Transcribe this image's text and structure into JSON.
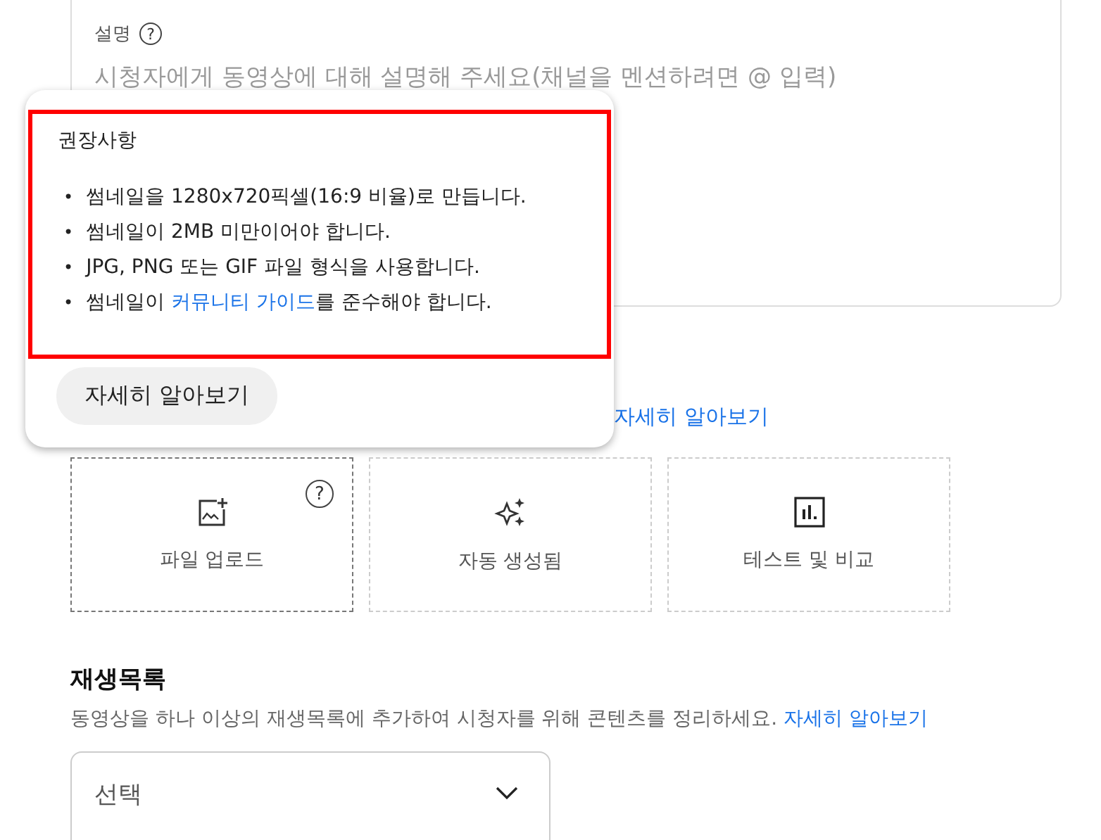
{
  "description": {
    "label": "설명",
    "help_icon": "?",
    "placeholder": "시청자에게 동영상에 대해 설명해 주세요(채널을 멘션하려면 @ 입력)"
  },
  "popup": {
    "title": "권장사항",
    "highlighted": true,
    "items": [
      {
        "bullet": "•",
        "text": "썸네일을 1280x720픽셀(16:9 비율)로 만듭니다."
      },
      {
        "bullet": "•",
        "text": "썸네일이 2MB 미만이어야 합니다."
      },
      {
        "bullet": "•",
        "text": "JPG, PNG 또는 GIF 파일 형식을 사용합니다."
      },
      {
        "bullet": "•",
        "text": "썸네일이 ",
        "link": "커뮤니티 가이드",
        "after": "를 준수해야 합니다."
      }
    ],
    "button": "자세히 알아보기"
  },
  "thumbnail": {
    "link": "자세히 알아보기",
    "options": [
      {
        "kind": "upload",
        "label": "파일 업로드",
        "selected": true,
        "help": "?"
      },
      {
        "kind": "auto",
        "label": "자동 생성됨",
        "selected": false
      },
      {
        "kind": "test",
        "label": "테스트 및 비교",
        "selected": false
      }
    ]
  },
  "playlist": {
    "title": "재생목록",
    "text": "동영상을 하나 이상의 재생목록에 추가하여 시청자를 위해 콘텐츠를 정리하세요.",
    "link": "자세히 알아보기",
    "select": {
      "value": "선택"
    }
  }
}
